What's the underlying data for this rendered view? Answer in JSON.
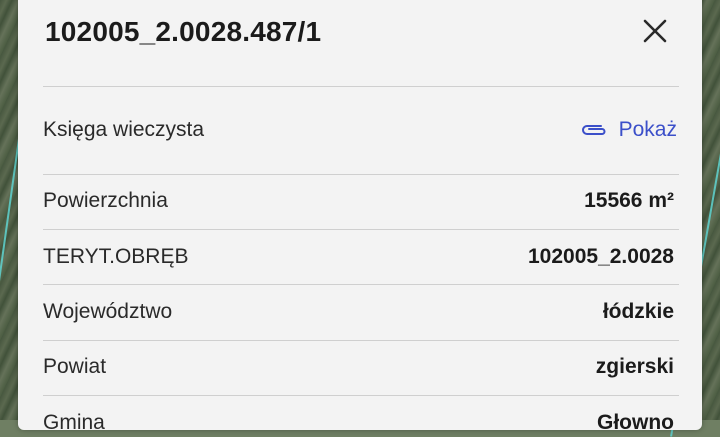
{
  "panel": {
    "title": "102005_2.0028.487/1",
    "close_icon": "close-icon"
  },
  "rows": [
    {
      "label": "Księga wieczysta",
      "link_label": "Pokaż",
      "link_icon": "paperclip-icon"
    },
    {
      "label": "Powierzchnia",
      "value": "15566 m²"
    },
    {
      "label": "TERYT.OBRĘB",
      "value": "102005_2.0028"
    },
    {
      "label": "Województwo",
      "value": "łódzkie"
    },
    {
      "label": "Powiat",
      "value": "zgierski"
    },
    {
      "label": "Gmina",
      "value": "Głowno"
    }
  ],
  "colors": {
    "link": "#3b4fc9",
    "panel_bg": "#f3f3f3"
  }
}
